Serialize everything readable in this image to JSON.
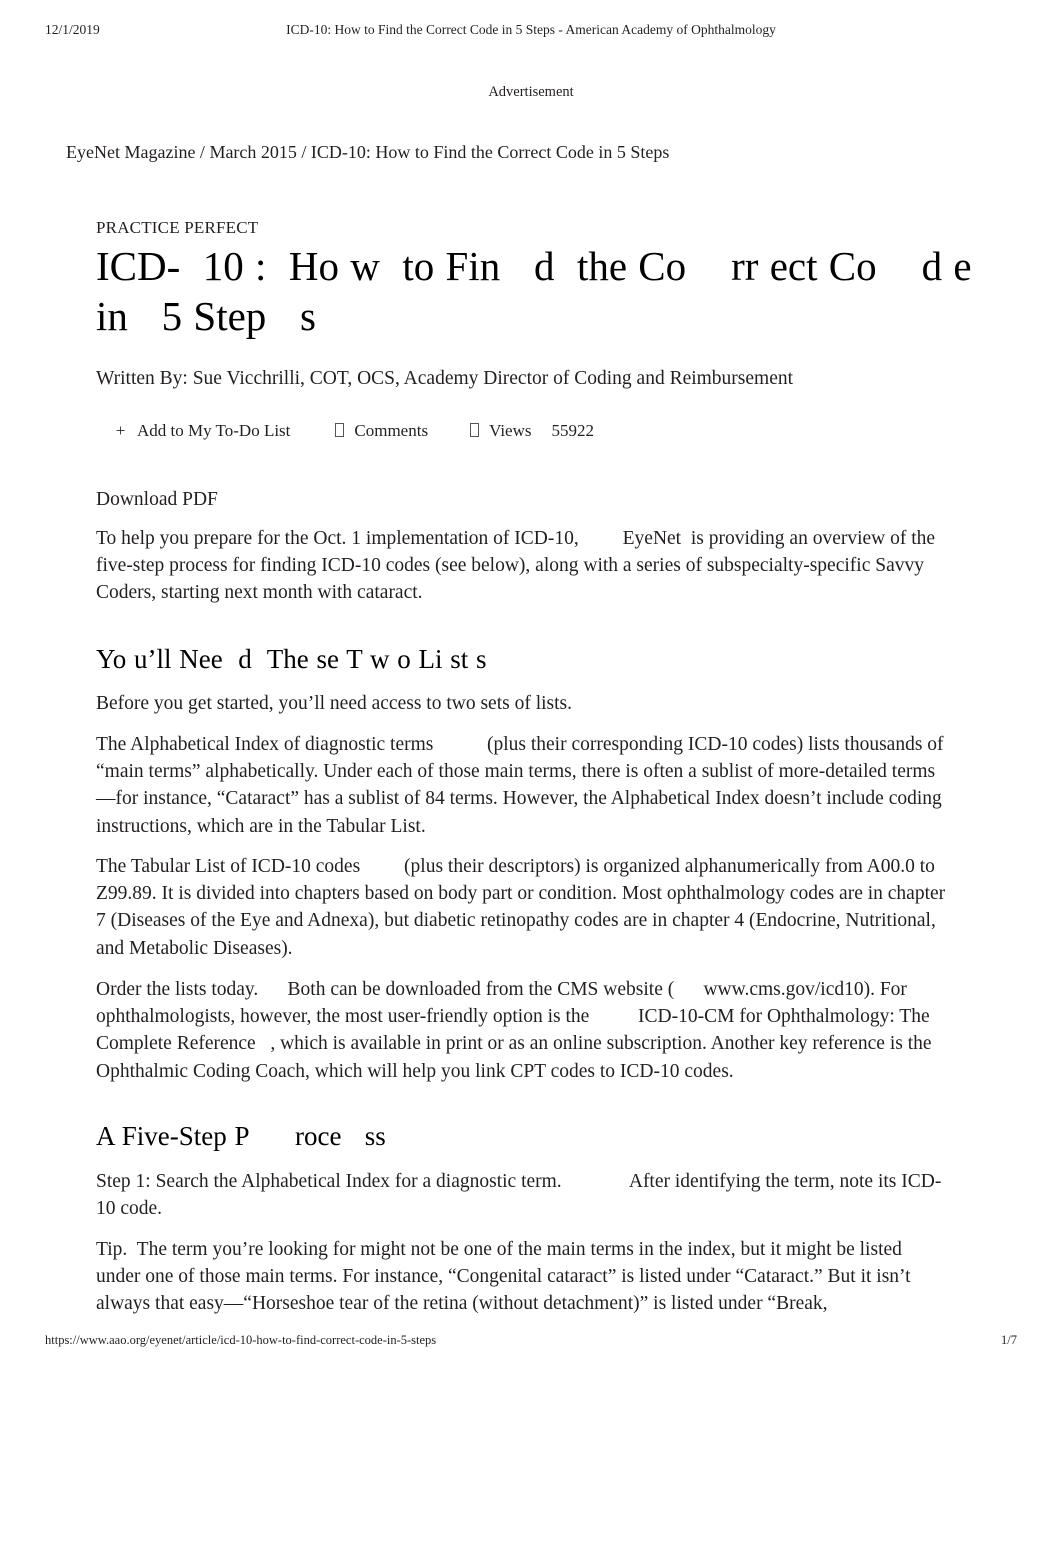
{
  "print_header": {
    "date": "12/1/2019",
    "title": "ICD-10: How to Find the Correct Code in 5 Steps - American Academy of Ophthalmology"
  },
  "advertisement": {
    "label": "Advertisement"
  },
  "breadcrumb": {
    "text": "EyeNet Magazine / March 2015 / ICD-10: How to Find the Correct Code in 5 Steps"
  },
  "article": {
    "eyebrow": "PRACTICE PERFECT",
    "headline": "ICD-  10 :  Ho w  to Fin   d  the Co    rr ect Co    d e in   5 Step   s",
    "byline": "Written By: Sue Vicchrilli, COT, OCS, Academy Director of Coding and Reimbursement",
    "actions": {
      "add_to_list_icon": "plus-icon",
      "add_to_list_label": "Add to My To-Do List",
      "comments_icon": "comment-icon-missing-glyph",
      "comments_label": "Comments",
      "views_icon": "views-icon-missing-glyph",
      "views_label": "Views",
      "views_count": "55922"
    },
    "download_pdf": "Download PDF",
    "intro": "To help you prepare for the Oct. 1 implementation of ICD-10,         EyeNet  is providing an overview of the five-step process for finding ICD-10 codes (see below), along with a series of subspecialty-specific Savvy Coders, starting next month with cataract.",
    "section_lists_heading": "Yo u’ll Nee  d  The se T w o Li st s",
    "before_you_start": "Before you get started, you’ll need access to two sets of lists.",
    "alphabetical_index": "The Alphabetical Index of diagnostic terms           (plus their corresponding ICD-10 codes) lists thousands of “main terms” alphabetically. Under each of those main terms, there is often a sublist of more-detailed terms—for instance, “Cataract” has a sublist of 84 terms. However, the Alphabetical Index doesn’t include coding instructions, which are in the Tabular List.",
    "tabular_list": "The Tabular List of ICD-10 codes         (plus their descriptors) is organized alphanumerically from A00.0 to Z99.89. It is divided into chapters based on body part or condition. Most ophthalmology codes are in chapter 7 (Diseases of the Eye and Adnexa), but diabetic retinopathy codes are in chapter 4 (Endocrine, Nutritional, and Metabolic Diseases).",
    "order_lists": "Order the lists today.      Both can be downloaded from the CMS website (      www.cms.gov/icd10). For ophthalmologists, however, the most user-friendly option is the          ICD-10-CM for Ophthalmology: The Complete Reference   , which is available in print or as an online subscription. Another key reference is the  Ophthalmic Coding Coach, which will help you link CPT codes to ICD-10 codes.",
    "section_process_heading": "A Five-Step P      roce   ss",
    "step_one": "Step 1: Search the Alphabetical Index for a diagnostic term.              After identifying the term, note its ICD-10 code.",
    "tip": "Tip.  The term you’re looking for might not be one of the main terms in the index, but it might be listed under one of those main terms. For instance, “Congenital cataract” is listed under “Cataract.” But it isn’t always that easy—“Horseshoe tear of the retina (without detachment)” is listed under “Break,"
  },
  "print_footer": {
    "url": "https://www.aao.org/eyenet/article/icd-10-how-to-find-correct-code-in-5-steps",
    "page": "1/7"
  }
}
